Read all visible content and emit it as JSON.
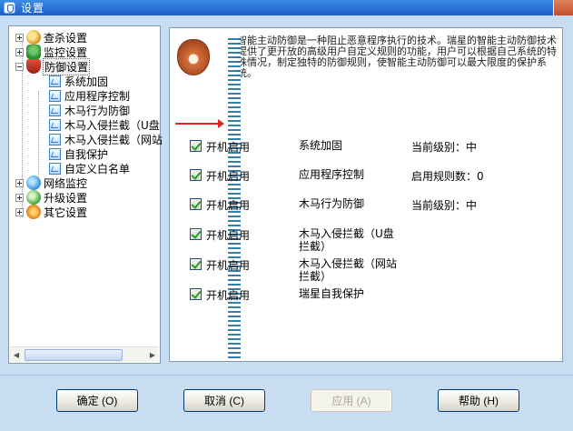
{
  "window": {
    "title": "设置"
  },
  "tree": {
    "nodes": [
      {
        "label": "查杀设置",
        "icon": "search-icon",
        "expander": "plus"
      },
      {
        "label": "监控设置",
        "icon": "monitor-icon",
        "expander": "plus"
      },
      {
        "label": "防御设置",
        "icon": "shield-icon",
        "expander": "minus",
        "selected": true
      },
      {
        "label": "系统加固",
        "child": true
      },
      {
        "label": "应用程序控制",
        "child": true
      },
      {
        "label": "木马行为防御",
        "child": true
      },
      {
        "label": "木马入侵拦截（U盘",
        "child": true
      },
      {
        "label": "木马入侵拦截（网站",
        "child": true
      },
      {
        "label": "自我保护",
        "child": true
      },
      {
        "label": "自定义白名单",
        "child": true
      },
      {
        "label": "网络监控",
        "icon": "network-icon",
        "expander": "plus"
      },
      {
        "label": "升级设置",
        "icon": "upgrade-icon",
        "expander": "plus"
      },
      {
        "label": "其它设置",
        "icon": "gear-icon",
        "expander": "plus"
      }
    ]
  },
  "content": {
    "description": "智能主动防御是一种阻止恶意程序执行的技术。瑞星的智能主动防御技术提供了更开放的高级用户自定义规则的功能，用户可以根据自己系统的特殊情况，制定独特的防御规则，使智能主动防御可以最大限度的保护系统。",
    "settings": [
      {
        "toggle": "开机启用",
        "name": "系统加固",
        "status": "当前级别：中",
        "checked": true
      },
      {
        "toggle": "开机启用",
        "name": "应用程序控制",
        "status": "启用规则数：0",
        "checked": true
      },
      {
        "toggle": "开机启用",
        "name": "木马行为防御",
        "status": "当前级别：中",
        "checked": true
      },
      {
        "toggle": "开机启用",
        "name": "木马入侵拦截（U盘拦截）",
        "status": "",
        "checked": true
      },
      {
        "toggle": "开机启用",
        "name": "木马入侵拦截（网站拦截）",
        "status": "",
        "checked": true
      },
      {
        "toggle": "开机启用",
        "name": "瑞星自我保护",
        "status": "",
        "checked": true
      }
    ]
  },
  "buttons": {
    "ok": "确定 (O)",
    "cancel": "取消 (C)",
    "apply": "应用 (A)",
    "help": "帮助 (H)"
  }
}
